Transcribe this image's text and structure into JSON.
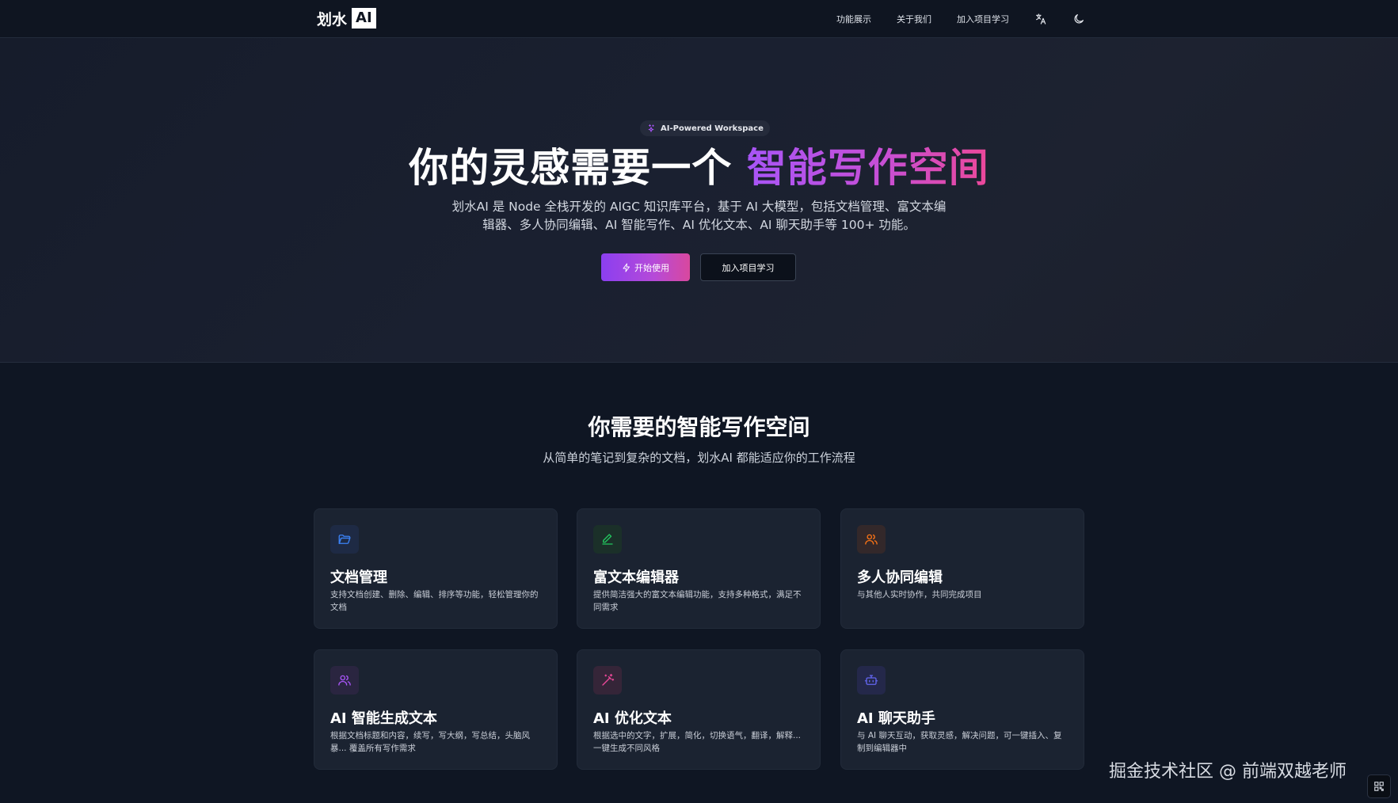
{
  "nav": {
    "logo_text": "划水",
    "logo_badge": "AI",
    "links": [
      "功能展示",
      "关于我们",
      "加入项目学习"
    ],
    "icons": [
      "translate-icon",
      "moon-icon"
    ]
  },
  "hero": {
    "pill": "AI-Powered Workspace",
    "title_plain": "你的灵感需要一个",
    "title_highlight": "智能写作空间",
    "description": "划水AI 是 Node 全栈开发的 AIGC 知识库平台，基于 AI 大模型，包括文档管理、富文本编辑器、多人协同编辑、AI 智能写作、AI 优化文本、AI 聊天助手等 100+ 功能。",
    "primary_button": "开始使用",
    "secondary_button": "加入项目学习"
  },
  "features": {
    "title": "你需要的智能写作空间",
    "subtitle": "从简单的笔记到复杂的文档，划水AI 都能适应你的工作流程",
    "cards": [
      {
        "title": "文档管理",
        "desc": "支持文档创建、删除、编辑、排序等功能，轻松管理你的文档",
        "icon": "folder-icon",
        "color": "#3b82f6",
        "bg": "#1e2a44"
      },
      {
        "title": "富文本编辑器",
        "desc": "提供简洁强大的富文本编辑功能，支持多种格式，满足不同需求",
        "icon": "pen-icon",
        "color": "#22c55e",
        "bg": "#1b3029"
      },
      {
        "title": "多人协同编辑",
        "desc": "与其他人实时协作，共同完成项目",
        "icon": "users-icon",
        "color": "#f97316",
        "bg": "#33282a"
      },
      {
        "title": "AI 智能生成文本",
        "desc": "根据文档标题和内容，续写，写大纲，写总结，头脑风暴... 覆盖所有写作需求",
        "icon": "users-ai-icon",
        "color": "#a855f7",
        "bg": "#2a2540"
      },
      {
        "title": "AI 优化文本",
        "desc": "根据选中的文字，扩展，简化，切换语气，翻译，解释... 一键生成不同风格",
        "icon": "magic-wand-icon",
        "color": "#ec4899",
        "bg": "#352538"
      },
      {
        "title": "AI 聊天助手",
        "desc": "与 AI 聊天互动，获取灵感，解决问题，可一键插入、复制到编辑器中",
        "icon": "bot-icon",
        "color": "#6366f1",
        "bg": "#24284a"
      }
    ]
  },
  "watermark": "掘金技术社区 @ 前端双越老师"
}
